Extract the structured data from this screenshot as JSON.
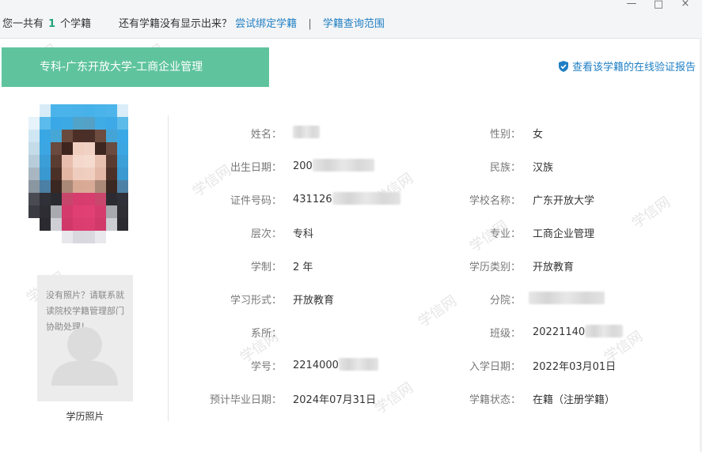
{
  "topbar": {
    "summary_prefix": "您一共有",
    "count": "1",
    "summary_suffix": "个学籍",
    "hint": "还有学籍没有显示出来？",
    "bind_link": "尝试绑定学籍",
    "separator": "|",
    "scope_link": "学籍查询范围",
    "window_controls": {
      "minimize": "—",
      "maximize": "□",
      "close": "×"
    }
  },
  "record": {
    "title": "专科-广东开放大学-工商企业管理",
    "verify_link": "查看该学籍的在线验证报告",
    "verify_icon": "shield-check-icon",
    "accent_color": "#5fc49d",
    "link_color": "#1f7fc4"
  },
  "photo": {
    "no_photo_msg": "没有照片？请联系就读院校学籍管理部门协助处理！",
    "caption": "学历照片"
  },
  "watermark": "学信网",
  "fields": [
    {
      "label": "姓名：",
      "value": ""
    },
    {
      "label": "性别：",
      "value": "女"
    },
    {
      "label": "出生日期：",
      "value": "200"
    },
    {
      "label": "民族：",
      "value": "汉族"
    },
    {
      "label": "证件号码：",
      "value": "431126"
    },
    {
      "label": "学校名称：",
      "value": "广东开放大学"
    },
    {
      "label": "层次：",
      "value": "专科"
    },
    {
      "label": "专业：",
      "value": "工商企业管理"
    },
    {
      "label": "学制：",
      "value": "2 年"
    },
    {
      "label": "学历类别：",
      "value": "开放教育"
    },
    {
      "label": "学习形式：",
      "value": "开放教育"
    },
    {
      "label": "分院：",
      "value": ""
    },
    {
      "label": "系所：",
      "value": ""
    },
    {
      "label": "班级：",
      "value": "20221140"
    },
    {
      "label": "学号：",
      "value": "2214000"
    },
    {
      "label": "入学日期：",
      "value": "2022年03月01日"
    },
    {
      "label": "预计毕业日期：",
      "value": "2024年07月31日"
    },
    {
      "label": "学籍状态：",
      "value": "在籍（注册学籍）"
    }
  ]
}
